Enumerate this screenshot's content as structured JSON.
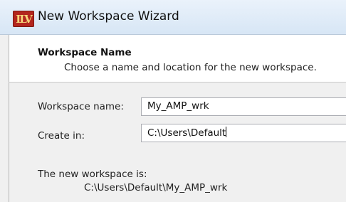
{
  "window": {
    "title": "New Workspace Wizard",
    "app_icon": "ilv-app-icon"
  },
  "header": {
    "title": "Workspace Name",
    "description": "Choose a name and location for the new workspace."
  },
  "form": {
    "workspace_name_label": "Workspace name:",
    "workspace_name_value": "My_AMP_wrk",
    "create_in_label": "Create in:",
    "create_in_value": "C:\\Users\\Default",
    "result_label": "The new workspace is:",
    "result_path": "C:\\Users\\Default\\My_AMP_wrk"
  }
}
